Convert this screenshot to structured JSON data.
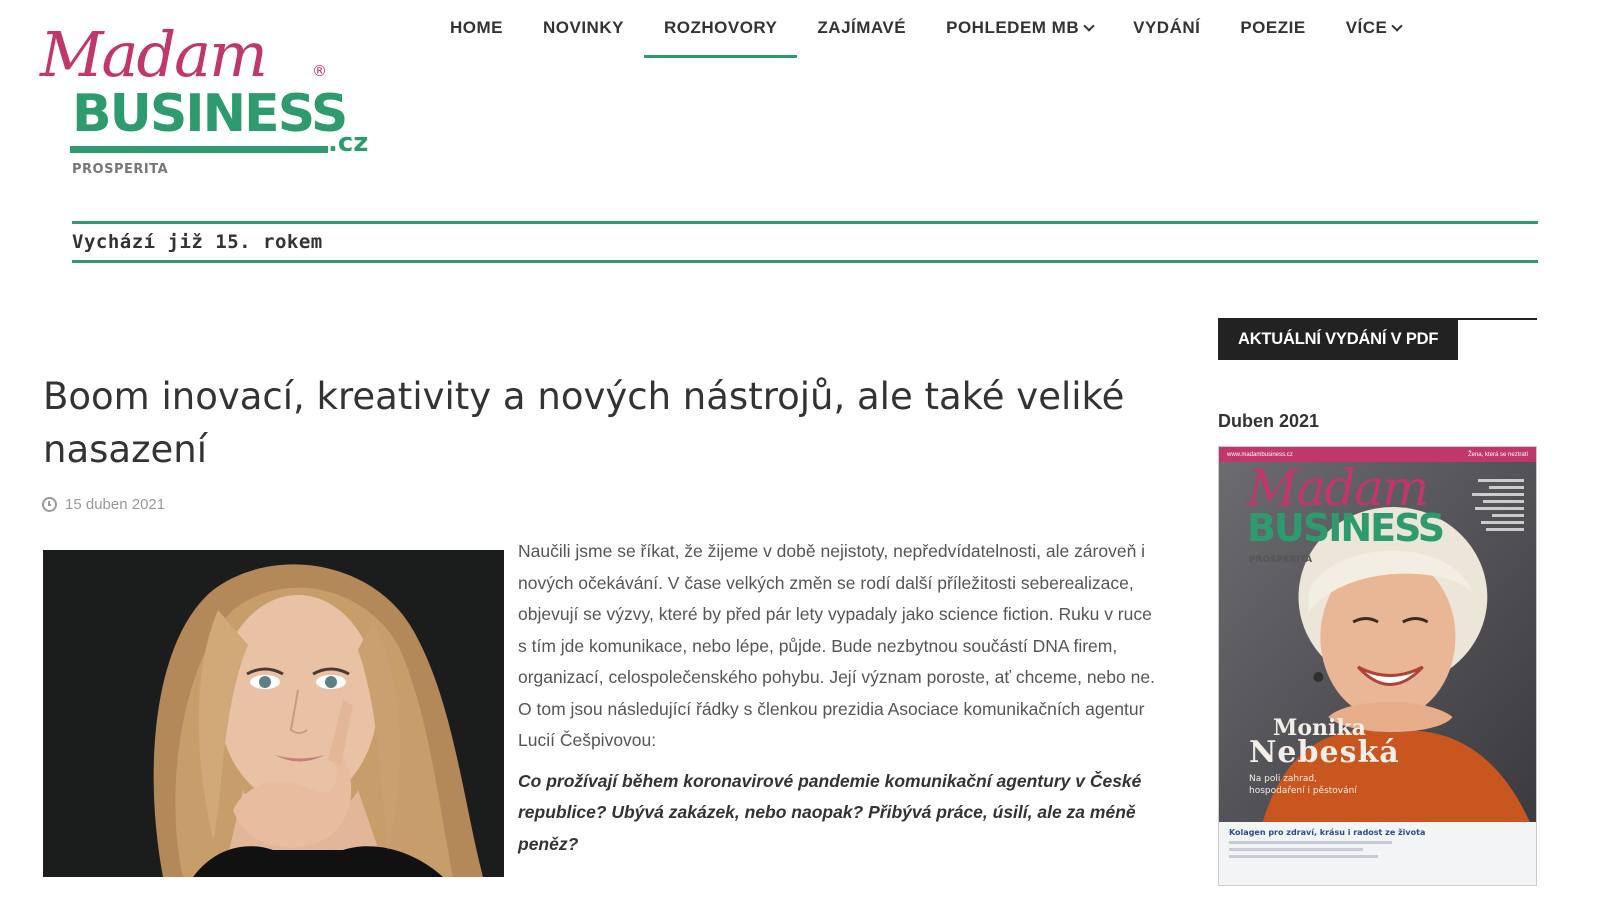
{
  "logo": {
    "script": "Madam",
    "registered": "®",
    "business": "BUSINESS",
    "tld": ".cz",
    "subtitle": "PROSPERITA"
  },
  "nav": {
    "items": [
      {
        "label": "HOME",
        "active": false,
        "dropdown": false
      },
      {
        "label": "NOVINKY",
        "active": false,
        "dropdown": false
      },
      {
        "label": "ROZHOVORY",
        "active": true,
        "dropdown": false
      },
      {
        "label": "ZAJÍMAVÉ",
        "active": false,
        "dropdown": false
      },
      {
        "label": "POHLEDEM MB",
        "active": false,
        "dropdown": true
      },
      {
        "label": "VYDÁNÍ",
        "active": false,
        "dropdown": false
      },
      {
        "label": "POEZIE",
        "active": false,
        "dropdown": false
      },
      {
        "label": "VÍCE",
        "active": false,
        "dropdown": true
      }
    ]
  },
  "tagline": "Vychází již 15. rokem",
  "article": {
    "title": "Boom inovací, kreativity a nových nástrojů, ale také veliké nasazení",
    "date": "15 duben 2021",
    "intro": "Naučili jsme se říkat, že žijeme v době nejistoty, nepředvídatelnosti, ale zároveň i nových očekávání. V čase velkých změn se rodí další příležitosti seberealizace, objevují se výzvy, které by před pár lety vypadaly jako science fiction. Ruku v ruce s tím jde komunikace, nebo lépe, půjde. Bude nezbytnou součástí DNA firem, organizací, celospolečenského pohybu. Její význam poroste, ať chceme, nebo ne. O tom jsou následující řádky s členkou prezidia Asociace komunikačních agentur Lucií Češpivovou:",
    "question": "Co prožívají během koronavirové pandemie komunikační agentury v České republice? Ubývá zakázek, nebo naopak? Přibývá práce, úsilí, ale za méně peněz?"
  },
  "sidebar": {
    "heading": "AKTUÁLNÍ VYDÁNÍ V PDF",
    "issue_label": "Duben 2021",
    "cover": {
      "topbar_left": "www.madambusiness.cz",
      "topbar_right": "Žena, která se neztratí",
      "logo_script": "Madam",
      "logo_business": "BUSINESS",
      "logo_subtitle": "PROSPERITA",
      "name_first": "Monika",
      "name_last": "Nebeská",
      "tagline_line1": "Na poli zahrad,",
      "tagline_line2": "hospodaření i pěstování",
      "bottom_title": "Kolagen pro zdraví, krásu i radost ze života"
    }
  },
  "colors": {
    "brand_pink": "#c0376b",
    "brand_green": "#2e9b6f",
    "text_dark": "#333333",
    "sidebar_heading_bg": "#222222"
  }
}
